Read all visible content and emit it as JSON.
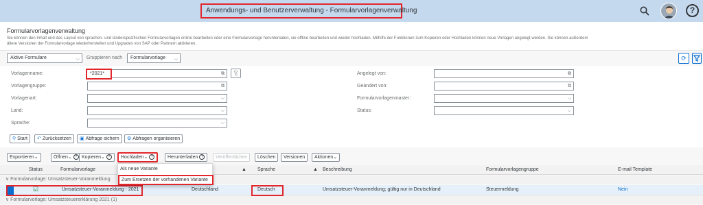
{
  "shell": {
    "title": "Anwendungs- und Benutzerverwaltung - Formularvorlagenverwaltung"
  },
  "page": {
    "title": "Formularvorlagenverwaltung",
    "description_line1": "Sie können den Inhalt und das Layout von sprachen- und länderspezifischen Formularvorlagen online bearbeiten oder eine Formularvorlage herunterladen, sie offline bearbeiten und wieder hochladen. Mithilfe der Funktionen zum Kopieren oder Hochladen können neue Vorlagen angelegt werden. Sie können außerdem",
    "description_line2": "ältere Versionen der Formularvorlage wiederherstellen und Upgrades von SAP oder Partnern aktivieren."
  },
  "variant": {
    "active_forms": "Aktive Formulare",
    "group_by_label": "Gruppieren nach",
    "group_by_value": "Formularvorlage"
  },
  "filters": {
    "template_name_label": "Vorlagenname:",
    "template_name_value": "*2021*",
    "template_group_label": "Vorlagengruppe:",
    "template_type_label": "Vorlagenart:",
    "country_label": "Land:",
    "language_label": "Sprache:",
    "created_by_label": "Angelegt von:",
    "changed_by_label": "Geändert von:",
    "master_label": "Formularvorlagenmaster:",
    "status_label": "Status:"
  },
  "filter_buttons": {
    "start": "Start",
    "reset": "Zurücksetzen",
    "save_query": "Abfrage sichern",
    "organize_queries": "Abfragen organisieren"
  },
  "table_toolbar": {
    "export": "Exportieren",
    "open": "Öffnen",
    "copy": "Kopieren",
    "upload": "Hochladen",
    "download": "Herunterladen",
    "publish": "Veröffentlichen",
    "delete": "Löschen",
    "versions": "Versionen",
    "actions": "Aktionen"
  },
  "upload_menu": {
    "as_new_variant": "Als neue Variante",
    "replace_variant": "Zum Ersetzen der vorhandenen Variante"
  },
  "table": {
    "headers": {
      "status": "Status",
      "template": "Formularvorlage",
      "language": "Sprache",
      "description": "Beschreibung",
      "template_group": "Formularvorlagengruppe",
      "email_template": "E-mail Template"
    },
    "group1": "Formularvorlage: Umsatzsteuer-Voranmeldung",
    "group2": "Formularvorlage: Umsatzsteuererklärung 2021 (1)",
    "row": {
      "template": "Umsatzsteuer-Voranmeldung - 2021",
      "country": "Deutschland",
      "language": "Deutsch",
      "description": "Umsatzsteuer-Voranmeldung; gültig nur in Deutschland",
      "group": "Steuermeldung",
      "email": "Nein"
    }
  },
  "colors": {
    "shell": "#c5d9ee",
    "accent": "#0a6ed1",
    "highlight": "#e2262c",
    "selected_row": "#e5f0fa"
  }
}
